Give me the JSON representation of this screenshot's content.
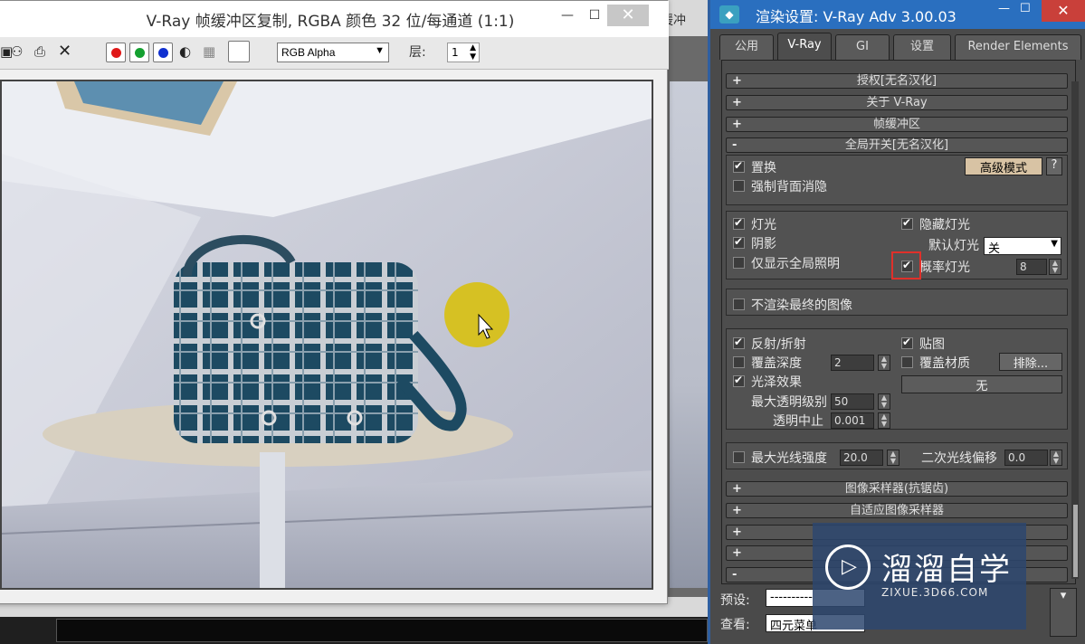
{
  "fb_window": {
    "title": "V-Ray 帧缓冲区复制, RGBA 颜色 32 位/每通道 (1:1)",
    "min": "—",
    "max": "☐",
    "close": "✕",
    "channel_select": "RGB Alpha",
    "layer_label": "层:",
    "layer_value": "1",
    "icons": [
      "save-icon",
      "binoculars-icon",
      "print-icon",
      "clear-icon"
    ]
  },
  "bg_window": {
    "title_fragment": "缓冲"
  },
  "render_settings": {
    "title": "渲染设置: V-Ray Adv 3.00.03",
    "tabs": [
      "公用",
      "V-Ray",
      "GI",
      "设置",
      "Render Elements"
    ],
    "active_tab": "V-Ray",
    "rollouts_top": [
      {
        "pm": "+",
        "label": "授权[无名汉化]"
      },
      {
        "pm": "+",
        "label": "关于 V-Ray"
      },
      {
        "pm": "+",
        "label": "帧缓冲区"
      },
      {
        "pm": "-",
        "label": "全局开关[无名汉化]"
      }
    ],
    "group1": {
      "displacement": "置换",
      "force_backface": "强制背面消隐",
      "expert_btn": "高级模式",
      "help_btn": "?"
    },
    "group2": {
      "lights": "灯光",
      "hidden_lights": "隐藏灯光",
      "shadows": "阴影",
      "default_lights": "默认灯光",
      "default_lights_value": "关",
      "gi_only": "仅显示全局照明",
      "prob_lights": "概率灯光",
      "prob_value": "8"
    },
    "group3": {
      "dont_render_final": "不渲染最终的图像"
    },
    "group4": {
      "refl_refr": "反射/折射",
      "maps": "贴图",
      "override_depth": "覆盖深度",
      "depth_value": "2",
      "override_mtl": "覆盖材质",
      "exclude_btn": "排除...",
      "glossy": "光泽效果",
      "none_btn": "无",
      "max_transp": "最大透明级别",
      "max_transp_value": "50",
      "transp_cutoff": "透明中止",
      "transp_cutoff_value": "0.001"
    },
    "group5": {
      "max_ray_int": "最大光线强度",
      "max_ray_value": "20.0",
      "sec_ray_bias": "二次光线偏移",
      "sec_ray_value": "0.0"
    },
    "rollouts_bottom": [
      {
        "pm": "+",
        "label": "图像采样器(抗锯齿)"
      },
      {
        "pm": "+",
        "label": "自适应图像采样器"
      },
      {
        "pm": "+",
        "label": ""
      },
      {
        "pm": "+",
        "label": ""
      },
      {
        "pm": "-",
        "label": ""
      }
    ],
    "preset_label": "预设:",
    "preset_value": "----------",
    "view_label": "查看:",
    "view_value": "四元菜单"
  },
  "watermark": {
    "text": "溜溜自学",
    "sub": "ZIXUE.3D66.COM"
  }
}
